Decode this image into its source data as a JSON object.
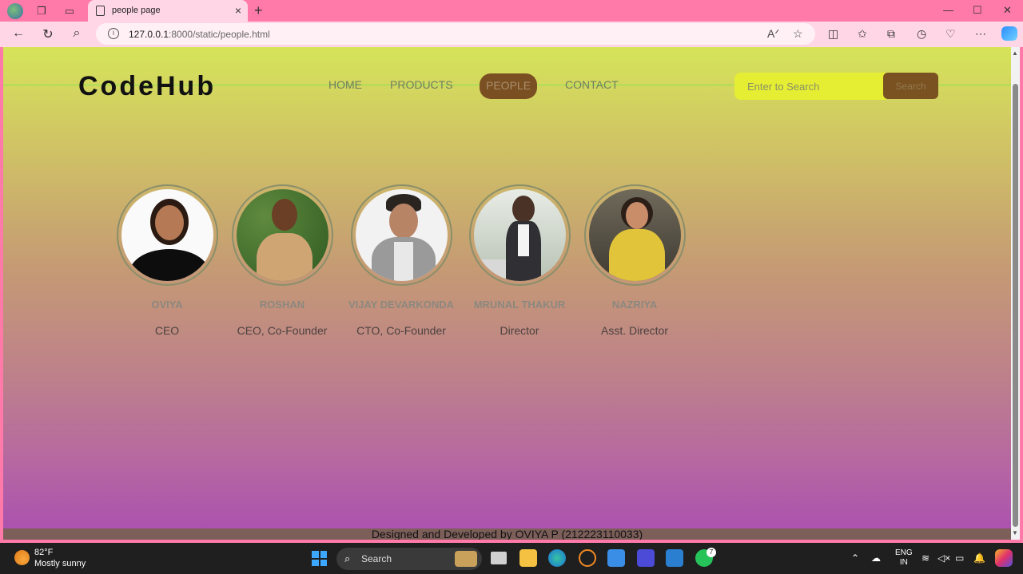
{
  "browser": {
    "tab_title": "people page",
    "tab_close": "×",
    "new_tab": "+",
    "url_host": "127.0.0.1",
    "url_rest": ":8000/static/people.html",
    "window_controls": [
      "—",
      "☐",
      "✕"
    ]
  },
  "site": {
    "logo": "CodeHub",
    "nav": [
      {
        "label": "HOME"
      },
      {
        "label": "PRODUCTS"
      },
      {
        "label": "PEOPLE",
        "active": true
      },
      {
        "label": "CONTACT"
      }
    ],
    "search": {
      "placeholder": "Enter to Search",
      "button": "Search"
    }
  },
  "people": [
    {
      "name": "OVIYA",
      "role": "CEO"
    },
    {
      "name": "ROSHAN",
      "role": "CEO, Co-Founder"
    },
    {
      "name": "VIJAY DEVARKONDA",
      "role": "CTO, Co-Founder"
    },
    {
      "name": "MRUNAL THAKUR",
      "role": "Director"
    },
    {
      "name": "NAZRIYA",
      "role": "Asst. Director"
    }
  ],
  "footer": "Designed and Developed by OVIYA P (212223110033)",
  "taskbar": {
    "temperature": "82°F",
    "condition": "Mostly sunny",
    "search_label": "Search",
    "language_top": "ENG",
    "language_bottom": "IN",
    "notification_count": "7"
  },
  "colors": {
    "tab_strip": "#ff79a9",
    "active_nav": "#7a4f21",
    "search_field": "#e6ee34"
  }
}
